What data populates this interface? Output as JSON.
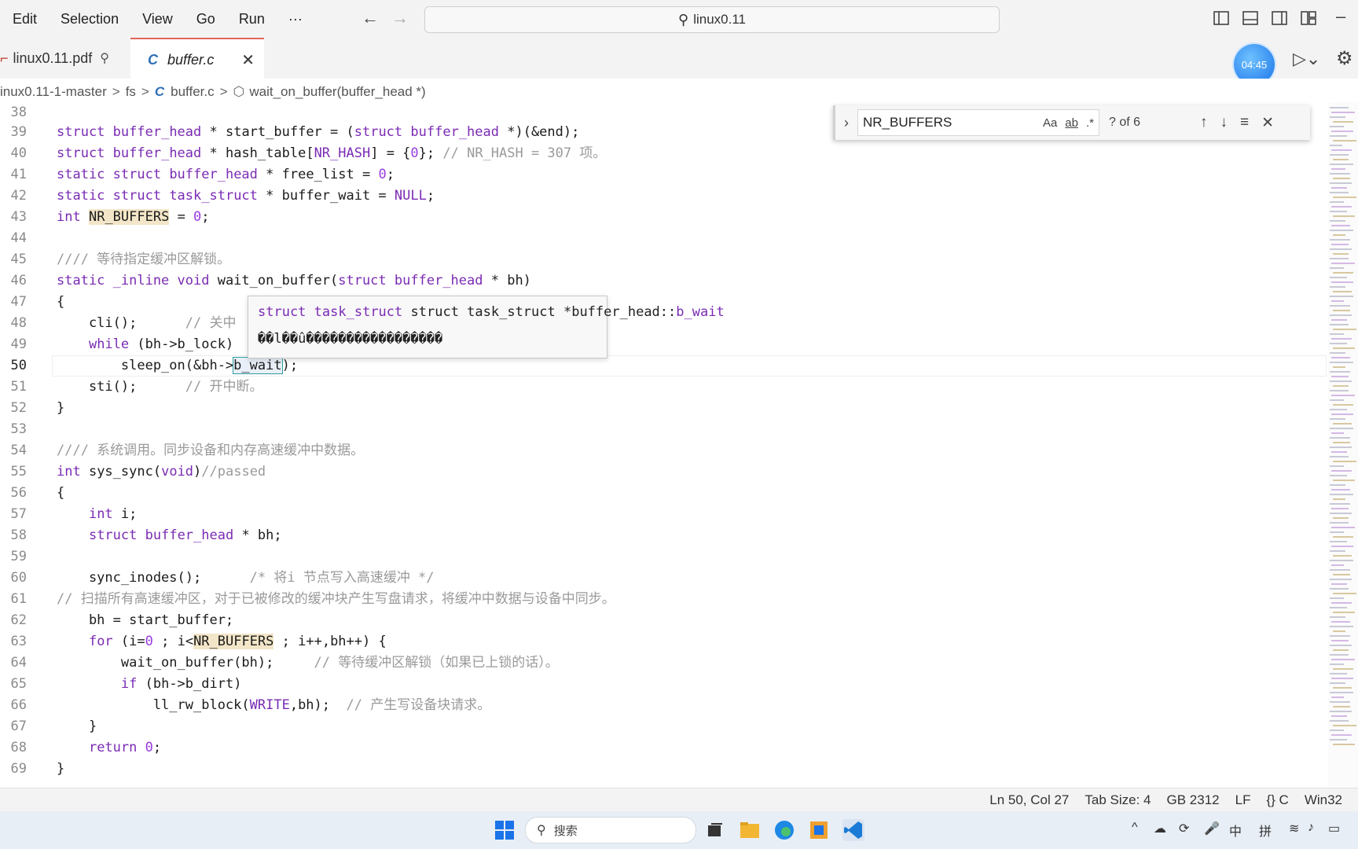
{
  "menu": [
    "Edit",
    "Selection",
    "View",
    "Go",
    "Run",
    "···"
  ],
  "command_center": {
    "text": "linux0.11"
  },
  "tabs": {
    "pdf": {
      "label": "linux0.11.pdf"
    },
    "buffer": {
      "icon": "C",
      "label": "buffer.c"
    }
  },
  "timer": "04:45",
  "breadcrumb": {
    "folder": "inux0.11-1-master",
    "sub": "fs",
    "file_icon": "C",
    "file": "buffer.c",
    "symbol": "wait_on_buffer(buffer_head *)"
  },
  "find": {
    "query": "NR_BUFFERS",
    "opt_case": "Aa",
    "opt_word": "ab",
    "opt_regex": ".*",
    "count": "? of 6"
  },
  "hover": {
    "sig_a": "struct task_struct *buffer_head::",
    "sig_b": "b_wait",
    "doc": "��l��û�����������������"
  },
  "code": {
    "l38": "38",
    "l39": "39",
    "l40": "40",
    "l41": "41",
    "l42": "42",
    "l43": "43",
    "l44": "44",
    "l45": "45",
    "l46": "46",
    "l47": "47",
    "l48": "48",
    "l49": "49",
    "l50": "50",
    "l51": "51",
    "l52": "52",
    "l53": "53",
    "l54": "54",
    "l55": "55",
    "l56": "56",
    "l57": "57",
    "l58": "58",
    "l59": "59",
    "l60": "60",
    "l61": "61",
    "l62": "62",
    "l63": "63",
    "l64": "64",
    "l65": "65",
    "l66": "66",
    "l67": "67",
    "l68": "68",
    "l69": "69",
    "c40_comment": "// NR_HASH = 307 项。",
    "c45": "//// 等待指定缓冲区解锁。",
    "c48_comment": "// 关中",
    "c49_tail": "。",
    "c51_comment": "// 开中断。",
    "c54": "//// 系统调用。同步设备和内存高速缓冲中数据。",
    "c55_comment": "//passed",
    "c60_comment": "/* 将i 节点写入高速缓冲 */",
    "c61": "// 扫描所有高速缓冲区，对于已被修改的缓冲块产生写盘请求，将缓冲中数据与设备中同步。",
    "c64_comment": "// 等待缓冲区解锁（如果已上锁的话）。",
    "c66_comment": "// 产生写设备块请求。"
  },
  "status": {
    "position": "Ln 50, Col 27",
    "tab_size": "Tab Size: 4",
    "encoding": "GB 2312",
    "eol": "LF",
    "language": "{} C",
    "platform": "Win32"
  },
  "taskbar": {
    "search_placeholder": "搜索",
    "ime_mode": "中",
    "ime_pinyin": "拼"
  }
}
